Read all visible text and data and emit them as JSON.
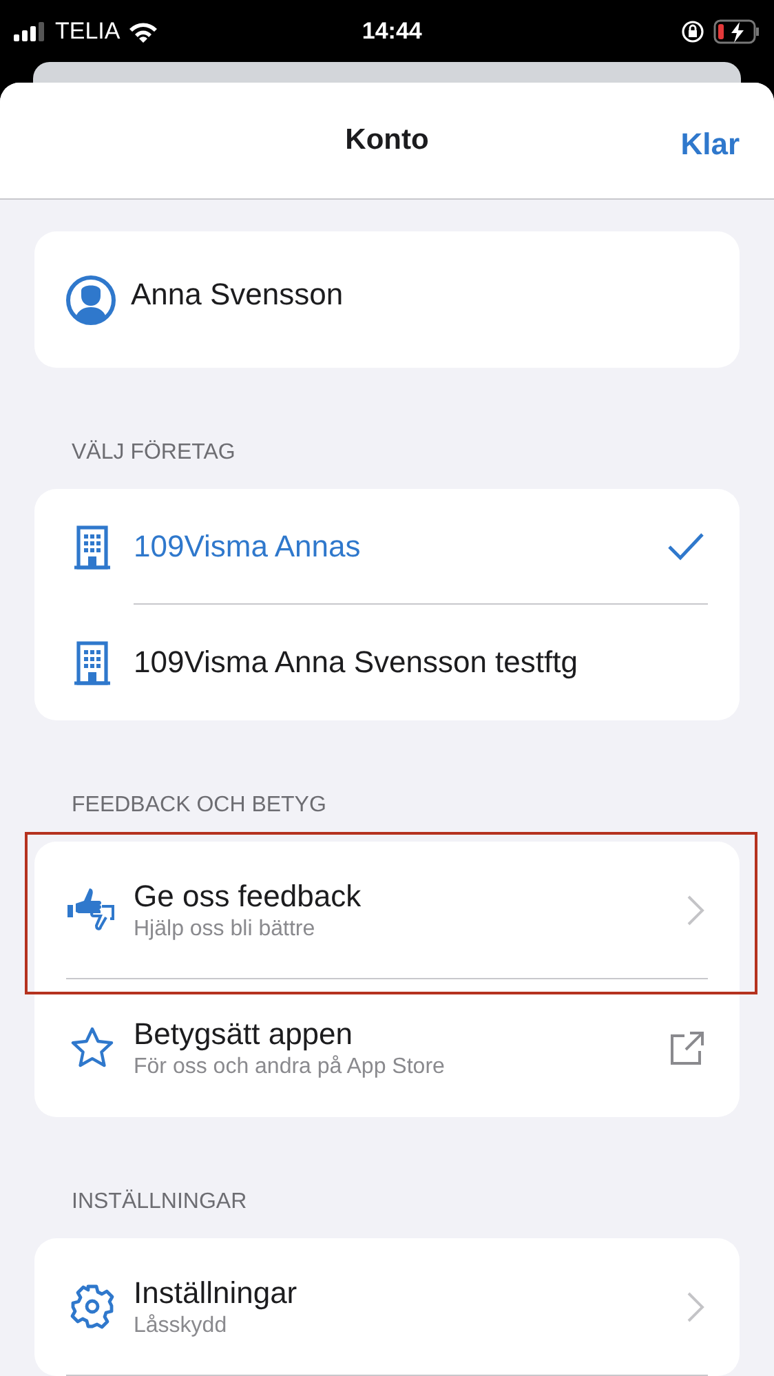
{
  "status_bar": {
    "carrier": "TELIA",
    "time": "14:44"
  },
  "header": {
    "title": "Konto",
    "done": "Klar"
  },
  "user": {
    "name": "Anna Svensson"
  },
  "sections": [
    {
      "title": "VÄLJ FÖRETAG",
      "items": [
        {
          "kind": "company",
          "title": "109Visma Annas",
          "selected": true
        },
        {
          "kind": "company",
          "title": "109Visma Anna Svensson testftg",
          "selected": false
        }
      ]
    },
    {
      "title": "FEEDBACK OCH BETYG",
      "items": [
        {
          "kind": "feedback",
          "title": "Ge oss feedback",
          "subtitle": "Hjälp oss bli bättre",
          "highlighted": true
        },
        {
          "kind": "rate",
          "title": "Betygsätt appen",
          "subtitle": "För oss och andra på App Store",
          "highlighted": false
        }
      ]
    },
    {
      "title": "INSTÄLLNINGAR",
      "items": [
        {
          "kind": "settings",
          "title": "Inställningar",
          "subtitle": "Låsskydd",
          "highlighted": false
        }
      ]
    }
  ]
}
